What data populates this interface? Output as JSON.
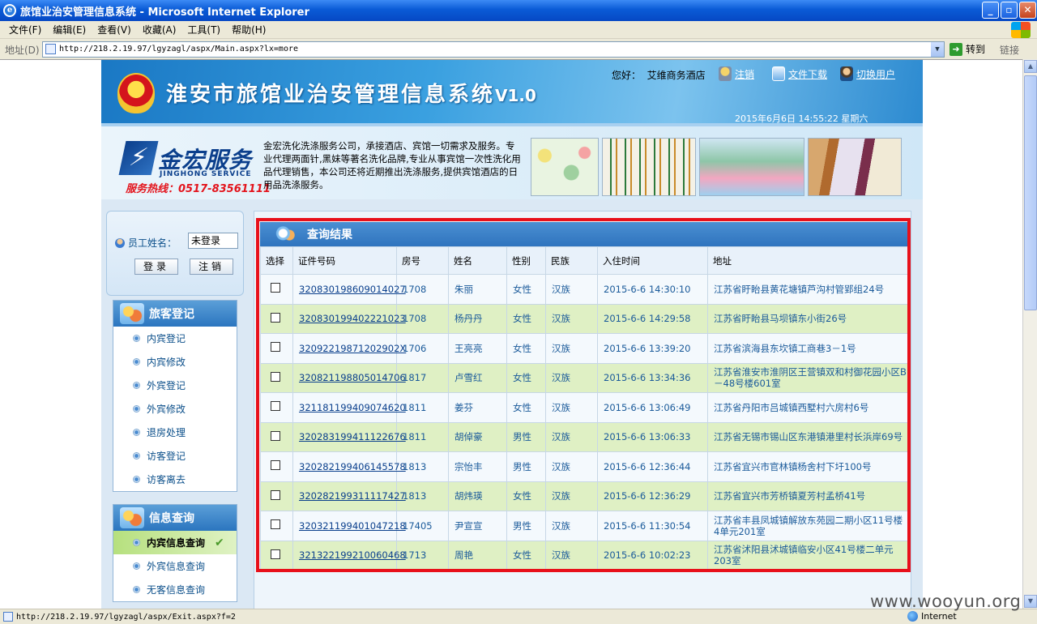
{
  "window": {
    "title": "旅馆业治安管理信息系统 - Microsoft Internet Explorer",
    "menu": [
      "文件(F)",
      "编辑(E)",
      "查看(V)",
      "收藏(A)",
      "工具(T)",
      "帮助(H)"
    ],
    "address_label": "地址(D)",
    "address_url": "http://218.2.19.97/lgyzagl/aspx/Main.aspx?lx=more",
    "go_label": "转到",
    "links_label": "链接",
    "status_url": "http://218.2.19.97/lgyzagl/aspx/Exit.aspx?f=2",
    "status_zone": "Internet",
    "watermark": "www.wooyun.org"
  },
  "header": {
    "system_title": "淮安市旅馆业治安管理信息系统",
    "version": "V1.0",
    "greeting_label": "您好：",
    "hotel_name": "艾维商务酒店",
    "logout_link": "注销",
    "download_link": "文件下载",
    "switch_link": "切换用户",
    "datetime": "2015年6月6日  14:55:22  星期六"
  },
  "banner": {
    "brand_name": "金宏服务",
    "brand_en": "JINGHONG SERVICE",
    "hotline": "服务热线：0517-83561111",
    "description": "金宏洗化洗涤服务公司，承接酒店、宾馆一切需求及服务。专业代理两面针,黑妹等著名洗化品牌,专业从事宾馆一次性洗化用品代理销售，本公司还将近期推出洗涤服务,提供宾馆酒店的日用品洗涤服务。"
  },
  "login": {
    "staff_label": "员工姓名：",
    "staff_value": "未登录",
    "login_button": "登录",
    "logout_button": "注销"
  },
  "menu_guest": {
    "title": "旅客登记",
    "items": [
      "内宾登记",
      "内宾修改",
      "外宾登记",
      "外宾修改",
      "退房处理",
      "访客登记",
      "访客离去"
    ]
  },
  "menu_query": {
    "title": "信息查询",
    "items": [
      "内宾信息查询",
      "外宾信息查询",
      "无客信息查询"
    ]
  },
  "results": {
    "title": "查询结果",
    "columns": [
      "选择",
      "证件号码",
      "房号",
      "姓名",
      "性别",
      "民族",
      "入住时间",
      "地址"
    ],
    "rows": [
      {
        "id": "320830198609014027",
        "room": "1708",
        "name": "朱丽",
        "gender": "女性",
        "ethnicity": "汉族",
        "checkin": "2015-6-6  14:30:10",
        "address": "江苏省盱眙县黄花塘镇芦沟村管郢组24号"
      },
      {
        "id": "320830199402221023",
        "room": "1708",
        "name": "杨丹丹",
        "gender": "女性",
        "ethnicity": "汉族",
        "checkin": "2015-6-6  14:29:58",
        "address": "江苏省盱眙县马坝镇东小街26号"
      },
      {
        "id": "32092219871202902X",
        "room": "1706",
        "name": "王亮亮",
        "gender": "女性",
        "ethnicity": "汉族",
        "checkin": "2015-6-6  13:39:20",
        "address": "江苏省滨海县东坎镇工商巷3－1号"
      },
      {
        "id": "320821198805014706",
        "room": "1817",
        "name": "卢雪红",
        "gender": "女性",
        "ethnicity": "汉族",
        "checkin": "2015-6-6  13:34:36",
        "address": "江苏省淮安市淮阴区王营镇双和村御花园小区B－48号楼601室"
      },
      {
        "id": "321181199409074620",
        "room": "1811",
        "name": "姜芬",
        "gender": "女性",
        "ethnicity": "汉族",
        "checkin": "2015-6-6  13:06:49",
        "address": "江苏省丹阳市吕城镇西墅村六房村6号"
      },
      {
        "id": "320283199411122676",
        "room": "1811",
        "name": "胡倬豪",
        "gender": "男性",
        "ethnicity": "汉族",
        "checkin": "2015-6-6  13:06:33",
        "address": "江苏省无锡市锡山区东港镇港里村长浜岸69号"
      },
      {
        "id": "320282199406145578",
        "room": "1813",
        "name": "宗怡丰",
        "gender": "男性",
        "ethnicity": "汉族",
        "checkin": "2015-6-6  12:36:44",
        "address": "江苏省宜兴市官林镇杨舍村下圩100号"
      },
      {
        "id": "320282199311117427",
        "room": "1813",
        "name": "胡炜瑛",
        "gender": "女性",
        "ethnicity": "汉族",
        "checkin": "2015-6-6  12:36:29",
        "address": "江苏省宜兴市芳桥镇夏芳村孟桥41号"
      },
      {
        "id": "320321199401047218",
        "room": "17405",
        "name": "尹宣宣",
        "gender": "男性",
        "ethnicity": "汉族",
        "checkin": "2015-6-6  11:30:54",
        "address": "江苏省丰县凤城镇解放东苑园二期小区11号楼4单元201室"
      },
      {
        "id": "321322199210060468",
        "room": "1713",
        "name": "周艳",
        "gender": "女性",
        "ethnicity": "汉族",
        "checkin": "2015-6-6  10:02:23",
        "address": "江苏省沭阳县沭城镇临安小区41号楼二单元203室"
      }
    ]
  },
  "colors": {
    "titlebar": "#0a5bd6",
    "header_blue": "#1a78c4",
    "highlight_red": "#e8101a",
    "row_even": "#dff0c4"
  }
}
